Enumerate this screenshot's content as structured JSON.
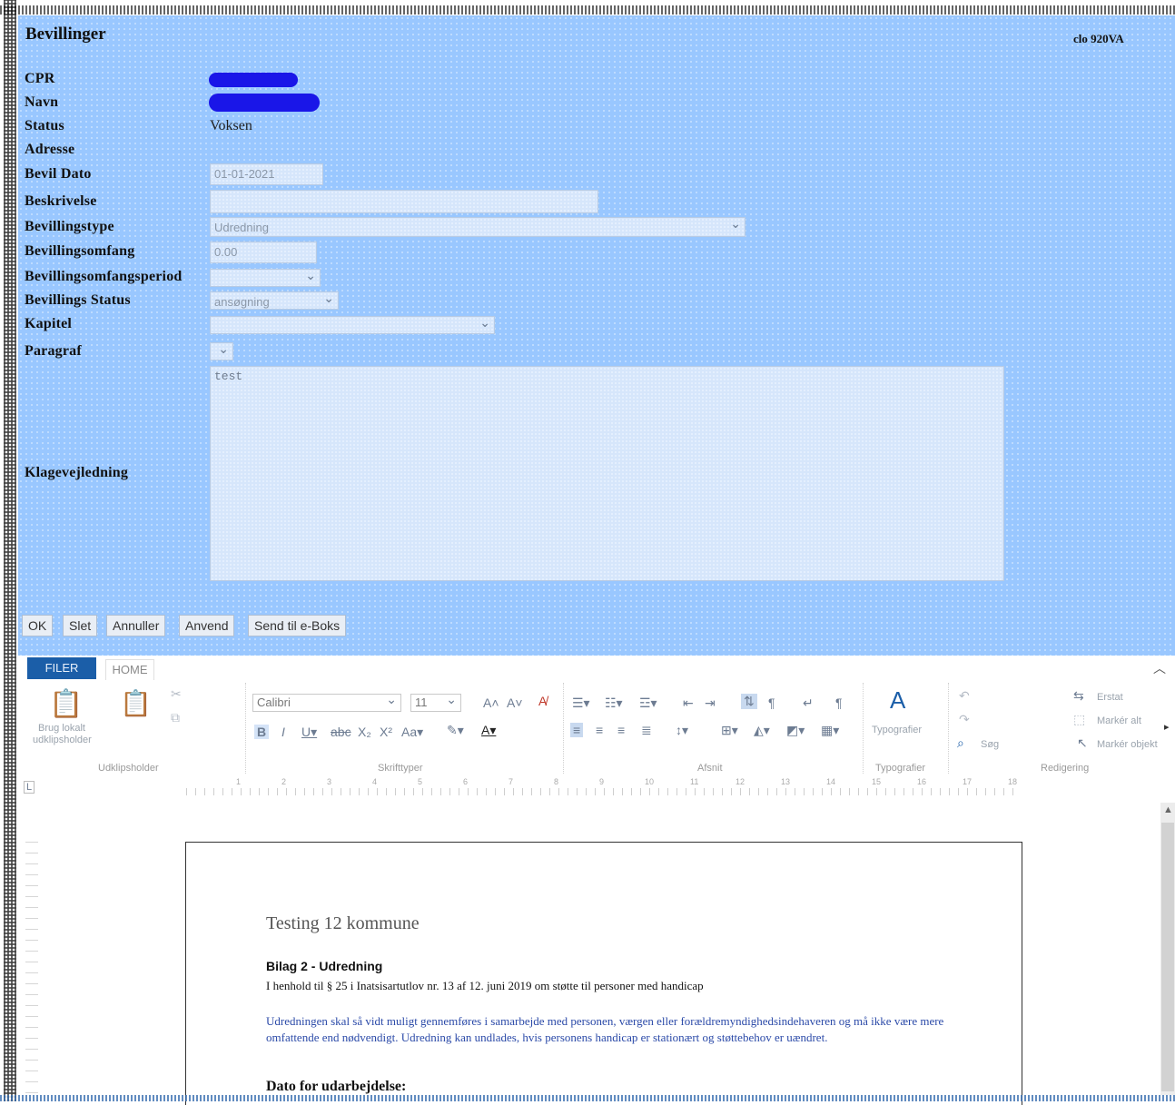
{
  "header": {
    "title": "Bevillinger",
    "top_right": "clo 920VA"
  },
  "form": {
    "labels": {
      "cpr": "CPR",
      "navn": "Navn",
      "status": "Status",
      "adresse": "Adresse",
      "bevil_dato": "Bevil Dato",
      "beskrivelse": "Beskrivelse",
      "bevillingstype": "Bevillingstype",
      "bevillingsomfang": "Bevillingsomfang",
      "bevillingsomfangsperiod": "Bevillingsomfangsperiod",
      "bevillings_status": "Bevillings Status",
      "kapitel": "Kapitel",
      "paragraf": "Paragraf",
      "klagevejledning": "Klagevejledning"
    },
    "values": {
      "status": "Voksen",
      "bevil_dato": "01-01-2021",
      "beskrivelse": "",
      "bevillingstype": "Udredning",
      "bevillingsomfang": "0.00",
      "bevillingsomfangsperiod": "",
      "bevillings_status": "ansøgning",
      "kapitel": "",
      "paragraf": "",
      "klagevejledning": "test"
    }
  },
  "buttons": {
    "ok": "OK",
    "slet": "Slet",
    "annuller": "Annuller",
    "anvend": "Anvend",
    "send": "Send til e-Boks"
  },
  "ribbon": {
    "tabs": {
      "filer": "FILER",
      "home": "HOME"
    },
    "clipboard": {
      "paste_label_1": "Brug lokalt",
      "paste_label_2": "udklipsholder",
      "group": "Udklipsholder"
    },
    "font": {
      "family": "Calibri",
      "size": "11",
      "group": "Skrifttyper"
    },
    "paragraph": {
      "group": "Afsnit"
    },
    "styles": {
      "label": "Typografier",
      "group": "Typografier"
    },
    "editing": {
      "replace": "Erstat",
      "select_all": "Markér alt",
      "search": "Søg",
      "select_objects": "Markér objekt",
      "group": "Redigering"
    }
  },
  "document": {
    "title": "Testing 12 kommune",
    "bilag": "Bilag 2 - Udredning",
    "line1": "I henhold til § 25 i Inatsisartutlov nr. 13 af 12. juni 2019 om støtte til personer med handicap",
    "para": "Udredningen skal så vidt muligt gennemføres i samarbejde med personen, værgen eller forældremyndighedsindehaveren og må ikke være mere omfattende end nødvendigt. Udredning kan undlades, hvis personens handicap er stationært og støttebehov er uændret.",
    "dato_heading": "Dato for udarbejdelse:"
  },
  "ruler_numbers": [
    "1",
    "2",
    "3",
    "4",
    "5",
    "6",
    "7",
    "8",
    "9",
    "10",
    "11",
    "12",
    "13",
    "14",
    "15",
    "16",
    "17",
    "18"
  ],
  "colors": {
    "panel": "#99c7ff",
    "redaction": "#1a16e8",
    "filer_tab": "#1b5ea8",
    "doc_blue": "#2b4aa8"
  }
}
